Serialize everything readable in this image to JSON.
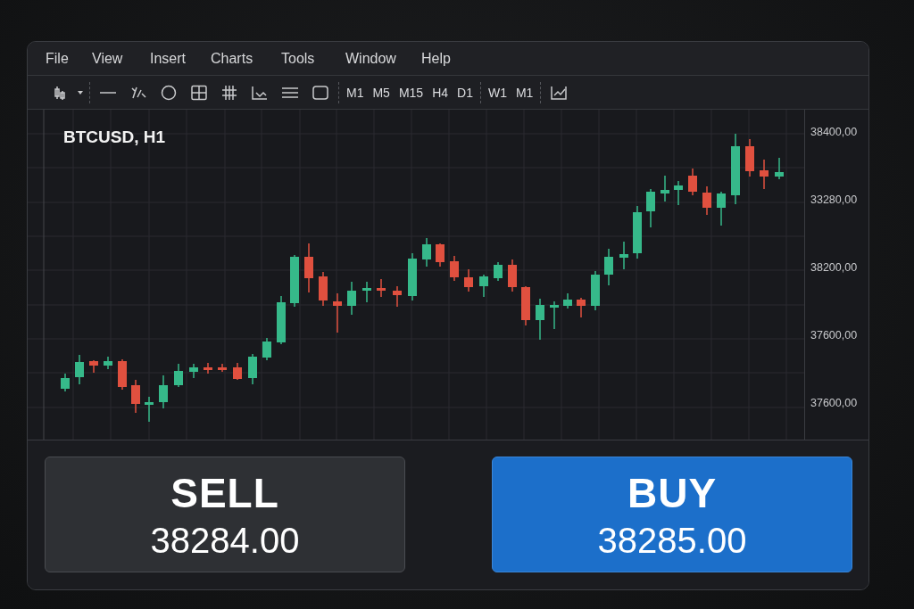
{
  "menu": [
    "File",
    "View",
    "Insert",
    "Charts",
    "Tools",
    "Window",
    "Help"
  ],
  "timeframe_groups": [
    [
      "M1",
      "M5",
      "M15",
      "H4",
      "D1"
    ],
    [
      "W1",
      "M1"
    ]
  ],
  "chart": {
    "symbol": "BTCUSD, H1",
    "price_axis": [
      "38400,00",
      "33280,00",
      "38200,00",
      "37600,00",
      "37600,00"
    ]
  },
  "orders": [
    {
      "kind": "sell",
      "label": "SELL",
      "price": "38284.00"
    },
    {
      "kind": "buy",
      "label": "BUY",
      "price": "38285.00"
    }
  ]
}
